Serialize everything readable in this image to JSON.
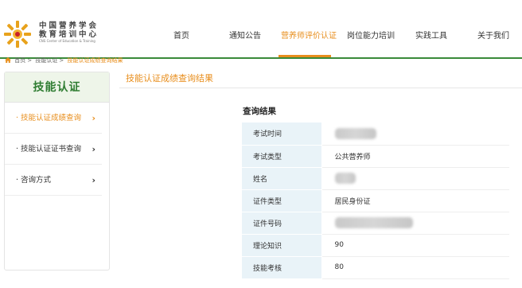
{
  "logo": {
    "name_line1": "中国营养学会",
    "name_line2": "教育培训中心",
    "name_line3": "CNS Center of Education & Training",
    "icon": "sunburst-logo"
  },
  "nav": {
    "items": [
      {
        "label": "首页"
      },
      {
        "label": "通知公告"
      },
      {
        "label": "营养师评价认证",
        "active": true
      },
      {
        "label": "岗位能力培训"
      },
      {
        "label": "实践工具"
      },
      {
        "label": "关于我们"
      }
    ]
  },
  "breadcrumb": {
    "home": "首页",
    "sep": ">",
    "level1": "技能认证",
    "current": "技能认证成绩查询结果"
  },
  "sidebar": {
    "title": "技能认证",
    "items": [
      {
        "label": "· 技能认证成绩查询",
        "active": true
      },
      {
        "label": "· 技能认证证书查询"
      },
      {
        "label": "· 咨询方式"
      }
    ],
    "chevron": "›"
  },
  "main": {
    "title": "技能认证成绩查询结果",
    "result_heading": "查询结果",
    "rows": [
      {
        "label": "考试时间",
        "value": "",
        "redacted": true
      },
      {
        "label": "考试类型",
        "value": "公共营养师"
      },
      {
        "label": "姓名",
        "value": "",
        "redacted": true
      },
      {
        "label": "证件类型",
        "value": "居民身份证"
      },
      {
        "label": "证件号码",
        "value": "",
        "redacted": true
      },
      {
        "label": "理论知识",
        "value": "90"
      },
      {
        "label": "技能考核",
        "value": "80"
      }
    ]
  },
  "colors": {
    "accent_orange": "#e88e1c",
    "brand_green": "#2f7d32",
    "label_bg": "#e9f3f8"
  }
}
